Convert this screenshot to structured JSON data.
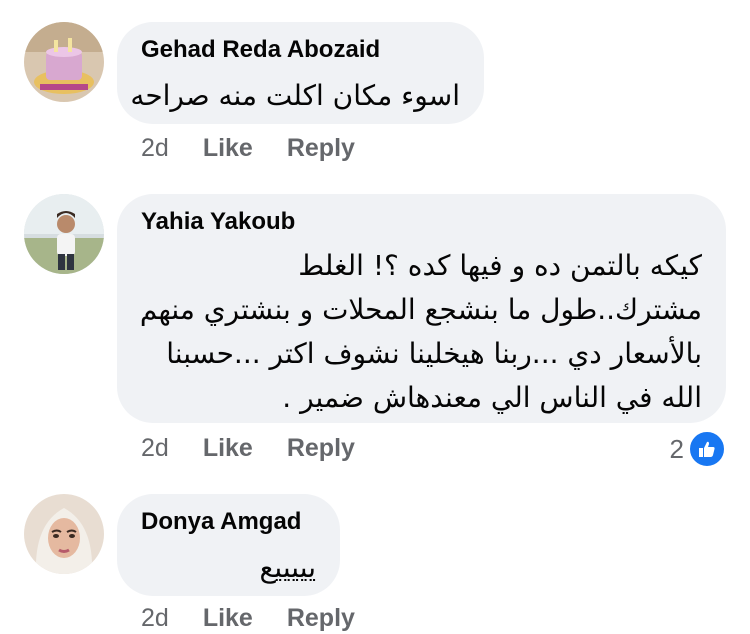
{
  "comments": [
    {
      "author": "Gehad Reda Abozaid",
      "body": [
        "اسوء مكان اكلت منه صراحه"
      ],
      "time": "2d",
      "like_label": "Like",
      "reply_label": "Reply"
    },
    {
      "author": "Yahia Yakoub",
      "body": [
        "كيكه بالتمن ده و فيها كده ؟! الغلط",
        "مشترك..طول ما بنشجع المحلات و بنشتري منهم",
        "بالأسعار دي ...ربنا هيخلينا نشوف اكتر ...حسبنا",
        "الله في الناس الي معندهاش ضمير ."
      ],
      "time": "2d",
      "like_label": "Like",
      "reply_label": "Reply",
      "reaction_count": "2",
      "reaction_icon": "like-icon"
    },
    {
      "author": "Donya Amgad",
      "body": [
        "يييييع"
      ],
      "time": "2d",
      "like_label": "Like",
      "reply_label": "Reply"
    }
  ],
  "colors": {
    "bubble": "#f0f2f5",
    "text": "#050505",
    "meta": "#65676b",
    "like_blue": "#1877f2"
  }
}
